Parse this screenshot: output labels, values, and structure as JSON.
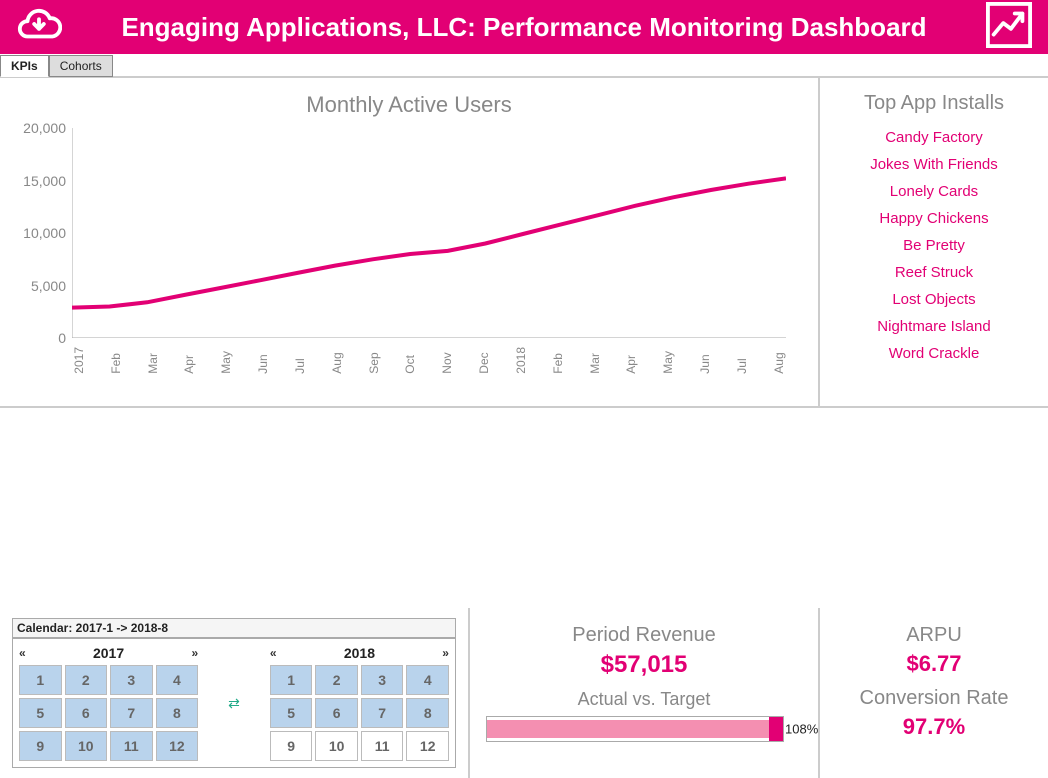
{
  "header": {
    "title": "Engaging Applications, LLC: Performance Monitoring Dashboard"
  },
  "tabs": {
    "kpis": "KPIs",
    "cohorts": "Cohorts",
    "active": "kpis"
  },
  "chart_data": {
    "type": "line",
    "title": "Monthly Active Users",
    "x": [
      "2017",
      "Feb",
      "Mar",
      "Apr",
      "May",
      "Jun",
      "Jul",
      "Aug",
      "Sep",
      "Oct",
      "Nov",
      "Dec",
      "2018",
      "Feb",
      "Mar",
      "Apr",
      "May",
      "Jun",
      "Jul",
      "Aug"
    ],
    "values": [
      2900,
      3000,
      3400,
      4100,
      4800,
      5500,
      6200,
      6900,
      7500,
      8000,
      8300,
      9000,
      9900,
      10800,
      11700,
      12600,
      13400,
      14100,
      14700,
      15200
    ],
    "ylim": [
      0,
      20000
    ],
    "yticks": [
      0,
      5000,
      10000,
      15000,
      20000
    ],
    "ytick_labels": [
      "0",
      "5,000",
      "10,000",
      "15,000",
      "20,000"
    ]
  },
  "top_apps": {
    "title": "Top App Installs",
    "items": [
      "Candy Factory",
      "Jokes With Friends",
      "Lonely Cards",
      "Happy Chickens",
      "Be Pretty",
      "Reef Struck",
      "Lost Objects",
      "Nightmare Island",
      "Word Crackle"
    ]
  },
  "calendar": {
    "title": "Calendar: 2017-1 -> 2018-8",
    "years": [
      {
        "year": "2017",
        "months": [
          1,
          2,
          3,
          4,
          5,
          6,
          7,
          8,
          9,
          10,
          11,
          12
        ],
        "selected": [
          1,
          2,
          3,
          4,
          5,
          6,
          7,
          8,
          9,
          10,
          11,
          12
        ]
      },
      {
        "year": "2018",
        "months": [
          1,
          2,
          3,
          4,
          5,
          6,
          7,
          8,
          9,
          10,
          11,
          12
        ],
        "selected": [
          1,
          2,
          3,
          4,
          5,
          6,
          7,
          8
        ]
      }
    ]
  },
  "revenue": {
    "title": "Period Revenue",
    "value": "$57,015",
    "subtitle": "Actual vs. Target",
    "percent_label": "108%",
    "percent": 108
  },
  "arpu": {
    "title": "ARPU",
    "value": "$6.77"
  },
  "conversion": {
    "title": "Conversion Rate",
    "value": "97.7%"
  }
}
